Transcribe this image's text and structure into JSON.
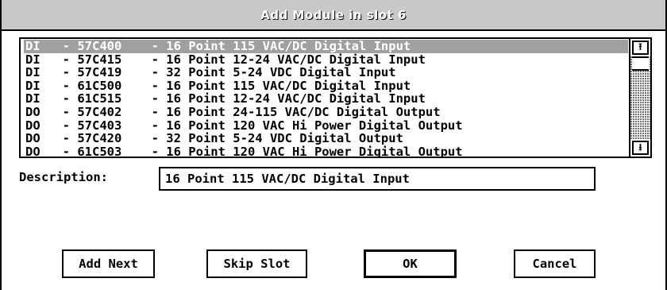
{
  "window": {
    "title": "Add Module in slot 6"
  },
  "module_list": {
    "selected_index": 0,
    "items": [
      {
        "label": "DI   - 57C400    - 16 Point 115 VAC/DC Digital Input"
      },
      {
        "label": "DI   - 57C415    - 16 Point 12-24 VAC/DC Digital Input"
      },
      {
        "label": "DI   - 57C419    - 32 Point 5-24 VDC Digital Input"
      },
      {
        "label": "DI   - 61C500    - 16 Point 115 VAC/DC Digital Input"
      },
      {
        "label": "DI   - 61C515    - 16 Point 12-24 VAC/DC Digital Input"
      },
      {
        "label": "DO   - 57C402    - 16 Point 24-115 VAC/DC Digital Output"
      },
      {
        "label": "DO   - 57C403    - 16 Point 120 VAC Hi Power Digital Output"
      },
      {
        "label": "DO   - 57C420    - 32 Point 5-24 VDC Digital Output"
      },
      {
        "label": "DO   - 61C503    - 16 Point 120 VAC Hi Power Digital Output"
      }
    ]
  },
  "scrollbar": {
    "up_icon": "arrow-up-icon",
    "down_icon": "arrow-down-icon",
    "up_glyph": "⭱",
    "down_glyph": "⭳"
  },
  "description": {
    "label": "Description:",
    "value": "16 Point 115 VAC/DC Digital Input"
  },
  "buttons": {
    "add_next": "Add Next",
    "skip_slot": "Skip Slot",
    "ok": "OK",
    "cancel": "Cancel"
  },
  "colors": {
    "title_bar": "#8a8a8a",
    "selection": "#5a5a5a",
    "background": "#ffffff",
    "border": "#000000"
  }
}
